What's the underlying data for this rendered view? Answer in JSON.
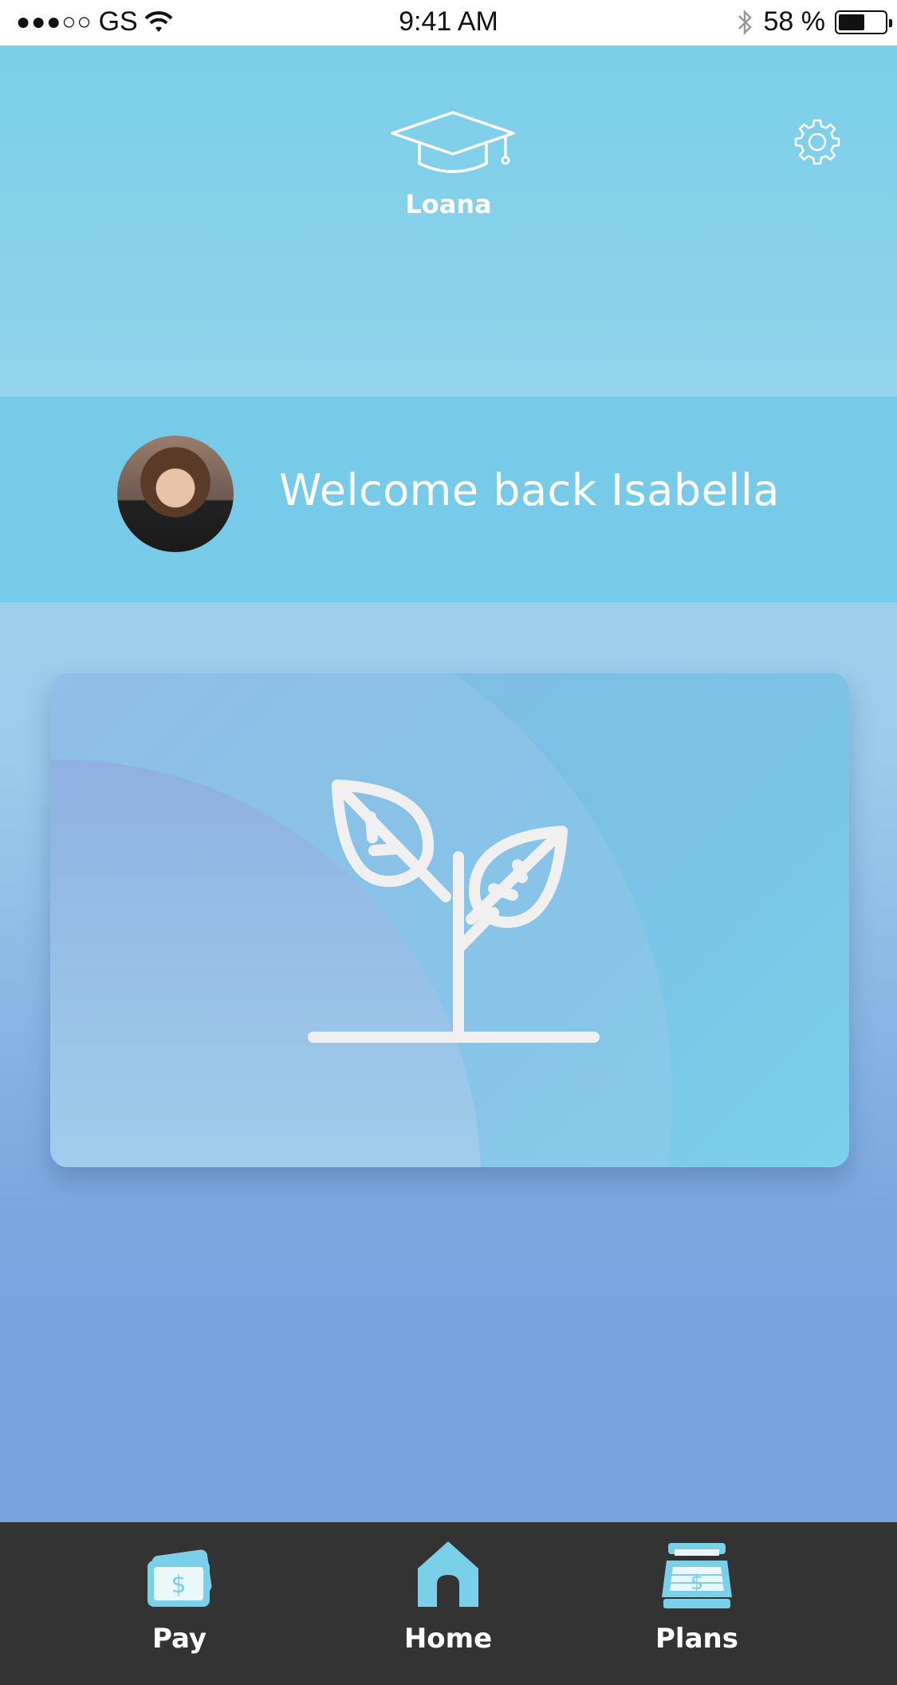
{
  "status_bar": {
    "signal": "●●●○○",
    "carrier": "GS",
    "time": "9:41 AM",
    "battery_text": "58 %",
    "battery_level": 0.58
  },
  "header": {
    "app_name": "Loana",
    "logo_icon": "graduation-cap-icon",
    "settings_icon": "gear-icon"
  },
  "welcome": {
    "text": "Welcome back Isabella"
  },
  "card": {
    "icon": "sprout-icon"
  },
  "bottom_nav": {
    "items": [
      {
        "label": "Pay",
        "icon": "money-icon"
      },
      {
        "label": "Home",
        "icon": "home-icon"
      },
      {
        "label": "Plans",
        "icon": "register-icon"
      }
    ]
  },
  "colors": {
    "accent": "#7acfe9",
    "nav_background": "#333333",
    "text_light": "#ffffff"
  }
}
